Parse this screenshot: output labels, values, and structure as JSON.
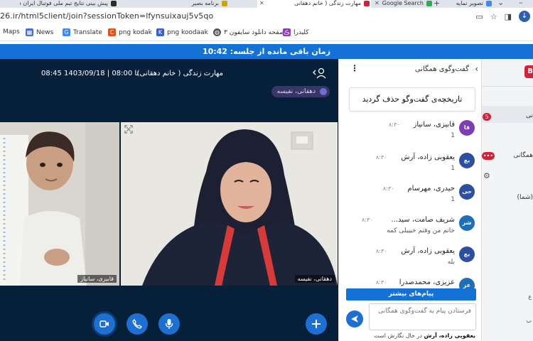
{
  "browser": {
    "tabs": [
      {
        "label": "پیش بینی نتایج تیم ملی فوتبال ایران در",
        "active": false,
        "color": "#2b2b2b"
      },
      {
        "label": "برنامه بصیر",
        "active": false,
        "color": "#c8a800"
      },
      {
        "label": "مهارت زندگی ( خانم دهقانی",
        "active": true,
        "color": "#d32238"
      },
      {
        "label": "Google Search",
        "active": false,
        "color": "#34a853"
      },
      {
        "label": "تصویر نمایه",
        "active": false,
        "color": "#4285f4"
      }
    ],
    "url_prefix": "26.ir/html5client/join?sessionToken=lfynsuixauj5v5qo",
    "bookmarks": [
      {
        "label": "Maps",
        "icon": "maps-icon",
        "color": "#34a853"
      },
      {
        "label": "News",
        "icon": "news-icon",
        "color": "#4a6fd1"
      },
      {
        "label": "Translate",
        "icon": "translate-icon",
        "color": "#4285f4"
      },
      {
        "label": "png kodak",
        "icon": "kodak-icon",
        "color": "#e0541a"
      },
      {
        "label": "png koodaak",
        "icon": "koodaak-icon",
        "color": "#3a5fcd"
      },
      {
        "label": "صفحه دانلود سایفون ۳",
        "icon": "globe-icon",
        "color": "#555555"
      },
      {
        "label": "کلیدرا",
        "icon": "keyboard-icon",
        "color": "#8b3fb5"
      }
    ]
  },
  "timer": {
    "text": "زمان باقی مانده از جلسه: 10:42"
  },
  "video": {
    "session_title": "مهارت زندگی ( خانم دهقانی)",
    "session_time": "08:45 تا 08:00 | 1403/09/18",
    "presenter_chip": "دهقانی، نفیسه",
    "tiles": [
      {
        "label": "قابیزی، سانیاز"
      },
      {
        "label": "دهقانی، نفیسه"
      }
    ]
  },
  "chat": {
    "title": "گفت‌وگوی همگانی",
    "cleared_notice": "تاریخچه‌ی گفت‌وگو حذف گردید",
    "messages": [
      {
        "initials": "قا",
        "name": "قابیزی، سانیاز",
        "time": "۸:۳۰",
        "body": "1",
        "color": "#7b3fb5"
      },
      {
        "initials": "یع",
        "name": "یعقوبی زاده، آرش",
        "time": "۸:۳۰",
        "body": "1",
        "color": "#2d4fa0"
      },
      {
        "initials": "حی",
        "name": "حیدری، مهرسام",
        "time": "۸:۳۰",
        "body": "1",
        "color": "#2d4fa0"
      },
      {
        "initials": "شر",
        "name": "شریف صامت، سید...",
        "time": "۸:۳۰",
        "body": "خانم من وقتم خیییلی کمه",
        "color": "#1e6fb8"
      },
      {
        "initials": "یع",
        "name": "یعقوبی زاده، آرش",
        "time": "۸:۳۰",
        "body": "بله",
        "color": "#2d4fa0"
      },
      {
        "initials": "عز",
        "name": "عزیزی، محمدصدرا",
        "time": "۸:۳۰",
        "body": "",
        "color": "#1e6fb8"
      }
    ],
    "more_messages": "پیام‌های بیشتر",
    "input_placeholder": "فرستادن پیام به گفت‌وگوی همگانی",
    "typing_name": "یعقوبی زاده، آرش",
    "typing_suffix": " در حال نگارش است"
  },
  "users_panel": {
    "logo": "B",
    "badge_count": "5",
    "item_public_chat": "نی",
    "item_shared_notes": "همگانی",
    "item_you": "(شما)"
  },
  "colors": {
    "accent": "#1472d6",
    "brand_red": "#d32238",
    "video_bg": "#06203a"
  }
}
